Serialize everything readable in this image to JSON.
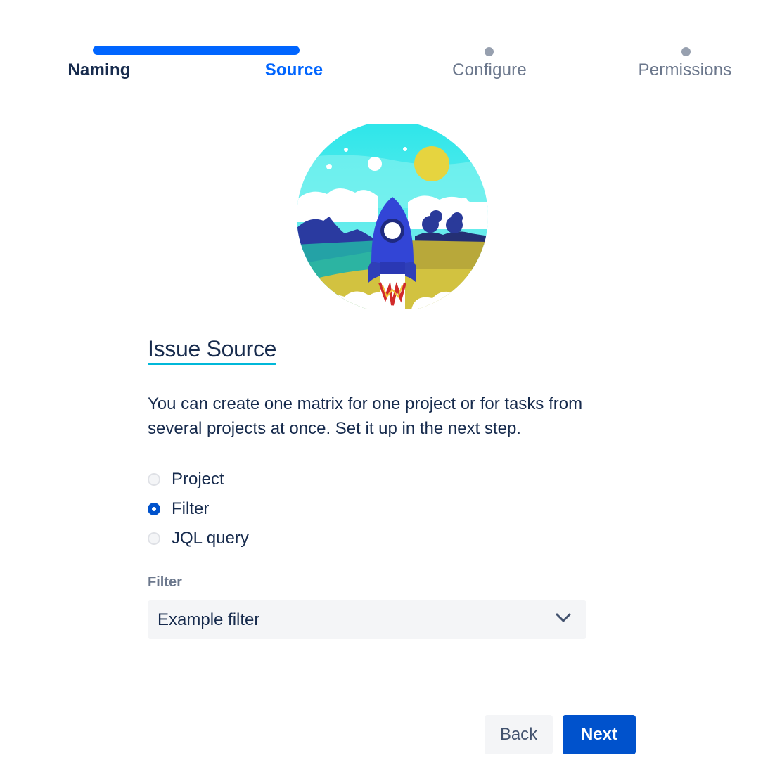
{
  "stepper": {
    "steps": [
      {
        "label": "Naming",
        "state": "done"
      },
      {
        "label": "Source",
        "state": "current"
      },
      {
        "label": "Configure",
        "state": "todo"
      },
      {
        "label": "Permissions",
        "state": "todo"
      }
    ]
  },
  "illustration": {
    "icon": "rocket-launch-illustration"
  },
  "section": {
    "title": "Issue Source",
    "description": "You can create one matrix for one project or for tasks from several projects at once. Set it up in the next step."
  },
  "source_options": [
    {
      "label": "Project",
      "selected": false
    },
    {
      "label": "Filter",
      "selected": true
    },
    {
      "label": "JQL query",
      "selected": false
    }
  ],
  "filter_field": {
    "label": "Filter",
    "value": "Example filter",
    "icon": "chevron-down-icon"
  },
  "actions": {
    "back_label": "Back",
    "next_label": "Next"
  },
  "colors": {
    "primary": "#0052cc",
    "progress": "#0065ff",
    "accent_underline": "#00b8d9"
  }
}
